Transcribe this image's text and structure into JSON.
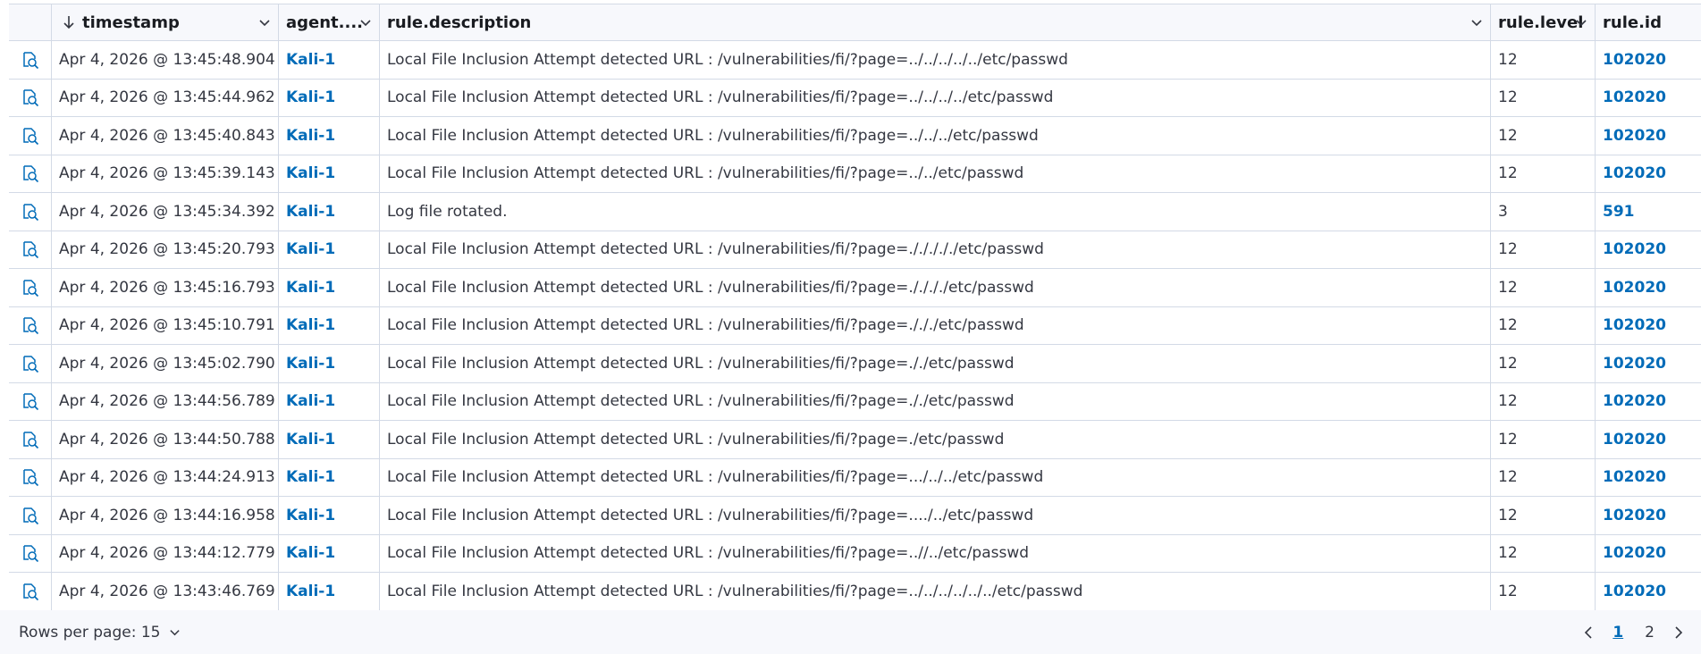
{
  "columns": {
    "timestamp": "timestamp",
    "agent": "agent....",
    "description": "rule.description",
    "level": "rule.level",
    "id": "rule.id"
  },
  "rows": [
    {
      "timestamp": "Apr 4, 2026 @ 13:45:48.904",
      "agent": "Kali-1",
      "description": "Local File Inclusion Attempt detected URL : /vulnerabilities/fi/?page=../../../../../etc/passwd",
      "level": "12",
      "id": "102020"
    },
    {
      "timestamp": "Apr 4, 2026 @ 13:45:44.962",
      "agent": "Kali-1",
      "description": "Local File Inclusion Attempt detected URL : /vulnerabilities/fi/?page=../../../../etc/passwd",
      "level": "12",
      "id": "102020"
    },
    {
      "timestamp": "Apr 4, 2026 @ 13:45:40.843",
      "agent": "Kali-1",
      "description": "Local File Inclusion Attempt detected URL : /vulnerabilities/fi/?page=../../../etc/passwd",
      "level": "12",
      "id": "102020"
    },
    {
      "timestamp": "Apr 4, 2026 @ 13:45:39.143",
      "agent": "Kali-1",
      "description": "Local File Inclusion Attempt detected URL : /vulnerabilities/fi/?page=../../etc/passwd",
      "level": "12",
      "id": "102020"
    },
    {
      "timestamp": "Apr 4, 2026 @ 13:45:34.392",
      "agent": "Kali-1",
      "description": "Log file rotated.",
      "level": "3",
      "id": "591"
    },
    {
      "timestamp": "Apr 4, 2026 @ 13:45:20.793",
      "agent": "Kali-1",
      "description": "Local File Inclusion Attempt detected URL : /vulnerabilities/fi/?page=./././././etc/passwd",
      "level": "12",
      "id": "102020"
    },
    {
      "timestamp": "Apr 4, 2026 @ 13:45:16.793",
      "agent": "Kali-1",
      "description": "Local File Inclusion Attempt detected URL : /vulnerabilities/fi/?page=././././etc/passwd",
      "level": "12",
      "id": "102020"
    },
    {
      "timestamp": "Apr 4, 2026 @ 13:45:10.791",
      "agent": "Kali-1",
      "description": "Local File Inclusion Attempt detected URL : /vulnerabilities/fi/?page=./././etc/passwd",
      "level": "12",
      "id": "102020"
    },
    {
      "timestamp": "Apr 4, 2026 @ 13:45:02.790",
      "agent": "Kali-1",
      "description": "Local File Inclusion Attempt detected URL : /vulnerabilities/fi/?page=././etc/passwd",
      "level": "12",
      "id": "102020"
    },
    {
      "timestamp": "Apr 4, 2026 @ 13:44:56.789",
      "agent": "Kali-1",
      "description": "Local File Inclusion Attempt detected URL : /vulnerabilities/fi/?page=././etc/passwd",
      "level": "12",
      "id": "102020"
    },
    {
      "timestamp": "Apr 4, 2026 @ 13:44:50.788",
      "agent": "Kali-1",
      "description": "Local File Inclusion Attempt detected URL : /vulnerabilities/fi/?page=./etc/passwd",
      "level": "12",
      "id": "102020"
    },
    {
      "timestamp": "Apr 4, 2026 @ 13:44:24.913",
      "agent": "Kali-1",
      "description": "Local File Inclusion Attempt detected URL : /vulnerabilities/fi/?page=.../../../etc/passwd",
      "level": "12",
      "id": "102020"
    },
    {
      "timestamp": "Apr 4, 2026 @ 13:44:16.958",
      "agent": "Kali-1",
      "description": "Local File Inclusion Attempt detected URL : /vulnerabilities/fi/?page=..../../etc/passwd",
      "level": "12",
      "id": "102020"
    },
    {
      "timestamp": "Apr 4, 2026 @ 13:44:12.779",
      "agent": "Kali-1",
      "description": "Local File Inclusion Attempt detected URL : /vulnerabilities/fi/?page=..//../etc/passwd",
      "level": "12",
      "id": "102020"
    },
    {
      "timestamp": "Apr 4, 2026 @ 13:43:46.769",
      "agent": "Kali-1",
      "description": "Local File Inclusion Attempt detected URL : /vulnerabilities/fi/?page=../../../../../../etc/passwd",
      "level": "12",
      "id": "102020"
    }
  ],
  "footer": {
    "rows_per_page": "Rows per page: 15",
    "pages": [
      "1",
      "2"
    ],
    "current_page": "1"
  },
  "colors": {
    "link": "#006bb8",
    "header_bg": "#f7f8fc",
    "border": "#d3dae6"
  },
  "icons": {
    "row_control": "inspect-document-icon",
    "sort": "arrow-down-icon",
    "column_menu": "chevron-down-icon",
    "prev": "chevron-left-icon",
    "next": "chevron-right-icon"
  }
}
